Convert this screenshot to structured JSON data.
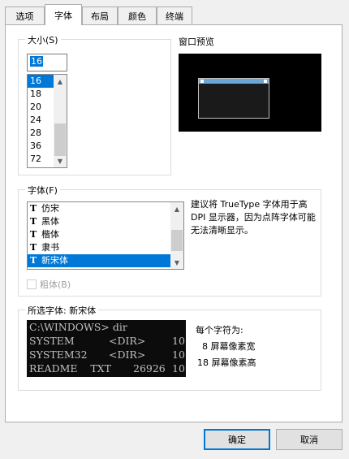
{
  "tabs": [
    {
      "label": "选项",
      "active": false
    },
    {
      "label": "字体",
      "active": true
    },
    {
      "label": "布局",
      "active": false
    },
    {
      "label": "颜色",
      "active": false
    },
    {
      "label": "终端",
      "active": false
    }
  ],
  "size_group": {
    "title": "大小(S)",
    "input_value": "16",
    "list": [
      "16",
      "18",
      "20",
      "24",
      "28",
      "36",
      "72"
    ],
    "selected": "16"
  },
  "preview": {
    "title": "窗口预览"
  },
  "font_group": {
    "title": "字体(F)",
    "fonts": [
      "仿宋",
      "黑体",
      "楷体",
      "隶书",
      "新宋体"
    ],
    "selected": "新宋体",
    "bold_label": "粗体(B)",
    "bold_checked": false,
    "hint": "建议将 TrueType 字体用于高 DPI 显示器，因为点阵字体可能无法清晰显示。"
  },
  "selected_font": {
    "title": "所选字体: 新宋体",
    "console_lines": [
      [
        "C:\\WINDOWS> dir",
        "",
        ""
      ],
      [
        "SYSTEM",
        "<DIR>",
        "10"
      ],
      [
        "SYSTEM32",
        "<DIR>",
        "10"
      ],
      [
        "README    TXT",
        "26926",
        "10"
      ]
    ],
    "char_size_label": "每个字符为:",
    "width_label": "8 屏幕像素宽",
    "height_label": "18 屏幕像素高"
  },
  "buttons": {
    "ok": "确定",
    "cancel": "取消"
  },
  "colors": {
    "accent": "#0078d7",
    "console_bg": "#0c0c0c",
    "console_fg": "#c0c0c0"
  }
}
